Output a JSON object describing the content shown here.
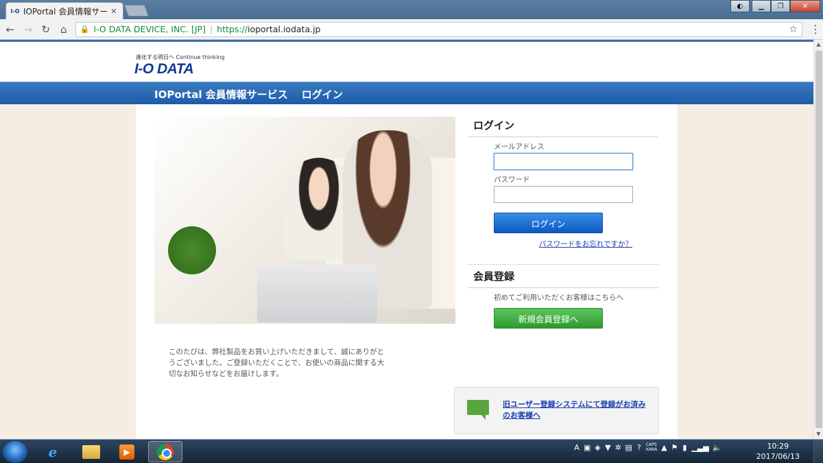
{
  "browser": {
    "tab_title": "IOPortal 会員情報サービス",
    "tab_favicon_text": "I-O",
    "tab_close": "✕",
    "lock_glyph": "🔒",
    "ev_label": "I-O DATA DEVICE, INC. [JP]",
    "url_scheme": "https://",
    "url_host": "ioportal.iodata.jp",
    "star_glyph": "☆",
    "menu_glyph": "⋮"
  },
  "site": {
    "tagline": "進化する明日へ Continue thinking",
    "logo": "I-O DATA",
    "nav_title": "IOPortal 会員情報サービス",
    "nav_page": "ログイン"
  },
  "intro": {
    "text": "このたびは、弊社製品をお買い上げいただきまして、誠にありがとうございました。ご登録いただくことで、お使いの商品に関する大切なお知らせなどをお届けします。"
  },
  "login": {
    "heading": "ログイン",
    "email_label": "メールアドレス",
    "email_value": "",
    "password_label": "パスワード",
    "password_value": "",
    "submit_label": "ログイン",
    "forgot_label": "パスワードをお忘れですか？"
  },
  "register": {
    "heading": "会員登録",
    "text": "初めてご利用いただくお客様はこちらへ",
    "button_label": "新規会員登録へ"
  },
  "legacy": {
    "link_text": "旧ユーザー登録システムにて登録がお済みのお客様へ"
  },
  "taskbar": {
    "ie_glyph": "e",
    "media_glyph": "▶",
    "tray": {
      "ime": "A",
      "caps_top": "CAPS",
      "caps_bottom": "KANA"
    },
    "clock_time": "10:29",
    "clock_date": "2017/06/13"
  },
  "colors": {
    "nav_blue": "#1d5ca8",
    "login_button": "#0d59c2",
    "register_button": "#2e9a2e",
    "link_blue": "#1a3fb0"
  }
}
